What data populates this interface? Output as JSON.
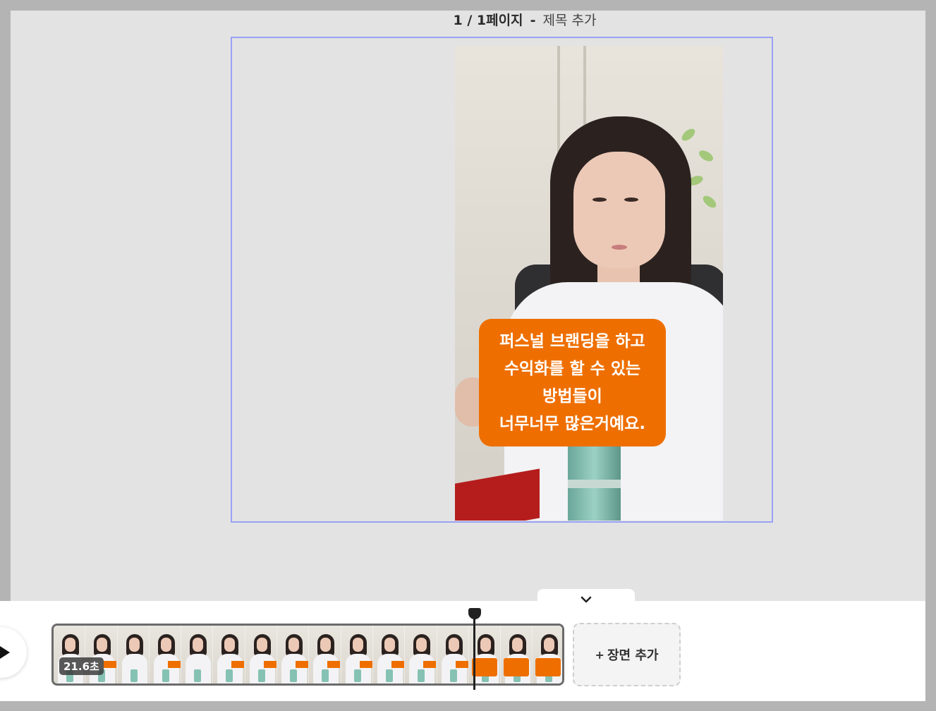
{
  "header": {
    "page_index": "1 / 1페이지",
    "separator": "-",
    "page_name": "제목 추가"
  },
  "caption": {
    "lines": [
      "퍼스널 브랜딩을 하고",
      "수익화를 할 수 있는",
      "방법들이",
      "너무너무 많은거예요."
    ]
  },
  "timeline": {
    "duration": "21.6초",
    "add_scene_plus": "+",
    "add_scene_label": "장면 추가",
    "playhead_progress": 0.82
  },
  "icons": {
    "play": "play-icon",
    "collapse": "chevron-down-icon"
  },
  "colors": {
    "caption_bg": "#ee6f00",
    "selection_border": "#9aa1f7",
    "canvas_bg": "#e3e3e3"
  }
}
